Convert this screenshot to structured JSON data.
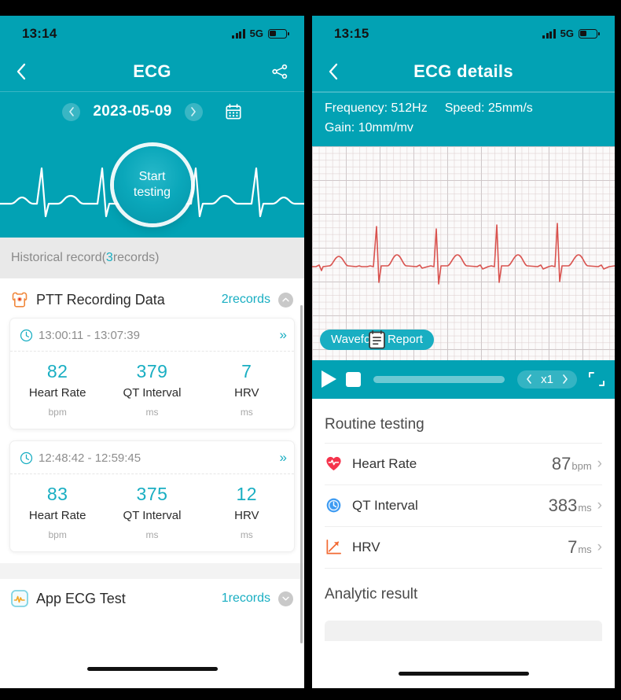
{
  "left": {
    "status": {
      "time": "13:14",
      "network": "5G"
    },
    "nav": {
      "title": "ECG",
      "back_icon": "chevron-left-icon",
      "share_icon": "share-icon"
    },
    "date": {
      "value": "2023-05-09",
      "prev_icon": "chevron-left-icon",
      "next_icon": "chevron-right-icon",
      "calendar_icon": "calendar-icon"
    },
    "hero": {
      "button_line1": "Start",
      "button_line2": "testing"
    },
    "historical": {
      "prefix": "Historical record(",
      "count": "3",
      "suffix": "records)"
    },
    "section": {
      "icon": "body-torso-icon",
      "title": "PTT Recording Data",
      "count": "2records",
      "collapse_icon": "chevron-up-icon"
    },
    "records": [
      {
        "time_range": "13:00:11 - 13:07:39",
        "clock_icon": "clock-icon",
        "more_icon": "double-chevron-right-icon",
        "metrics": [
          {
            "value": "82",
            "name": "Heart Rate",
            "unit": "bpm"
          },
          {
            "value": "379",
            "name": "QT Interval",
            "unit": "ms"
          },
          {
            "value": "7",
            "name": "HRV",
            "unit": "ms"
          }
        ]
      },
      {
        "time_range": "12:48:42 - 12:59:45",
        "clock_icon": "clock-icon",
        "more_icon": "double-chevron-right-icon",
        "metrics": [
          {
            "value": "83",
            "name": "Heart Rate",
            "unit": "bpm"
          },
          {
            "value": "375",
            "name": "QT Interval",
            "unit": "ms"
          },
          {
            "value": "12",
            "name": "HRV",
            "unit": "ms"
          }
        ]
      }
    ],
    "bottom_section": {
      "icon": "app-ecg-icon",
      "title": "App ECG Test",
      "count": "1records",
      "collapse_icon": "chevron-down-icon"
    }
  },
  "right": {
    "status": {
      "time": "13:15",
      "network": "5G"
    },
    "nav": {
      "title": "ECG details",
      "back_icon": "chevron-left-icon"
    },
    "params": {
      "frequency": "Frequency: 512Hz",
      "speed": "Speed: 25mm/s",
      "gain": "Gain: 10mm/mv"
    },
    "waveform": {
      "report_badge": "Waveform Report",
      "report_icon": "document-icon",
      "trace_color": "#d9534f"
    },
    "player": {
      "play_icon": "play-icon",
      "stop_icon": "stop-icon",
      "progress_percent": 0,
      "speed_prev_icon": "chevron-left-icon",
      "speed_value": "x1",
      "speed_next_icon": "chevron-right-icon",
      "expand_icon": "fullscreen-icon"
    },
    "routine": {
      "title": "Routine testing",
      "rows": [
        {
          "icon": "heart-pulse-icon",
          "label": "Heart Rate",
          "value": "87",
          "unit": "bpm",
          "chevron": "chevron-right-icon"
        },
        {
          "icon": "clock-blue-icon",
          "label": "QT Interval",
          "value": "383",
          "unit": "ms",
          "chevron": "chevron-right-icon"
        },
        {
          "icon": "trend-chart-icon",
          "label": "HRV",
          "value": "7",
          "unit": "ms",
          "chevron": "chevron-right-icon"
        }
      ]
    },
    "analytic": {
      "title": "Analytic result"
    }
  },
  "theme": {
    "teal": "#02A2B4",
    "teal_accent": "#19aec2",
    "ecg_red": "#d9534f",
    "heart_red": "#f5334c",
    "clock_blue": "#3d9bf2",
    "trend_orange": "#f26a33"
  }
}
